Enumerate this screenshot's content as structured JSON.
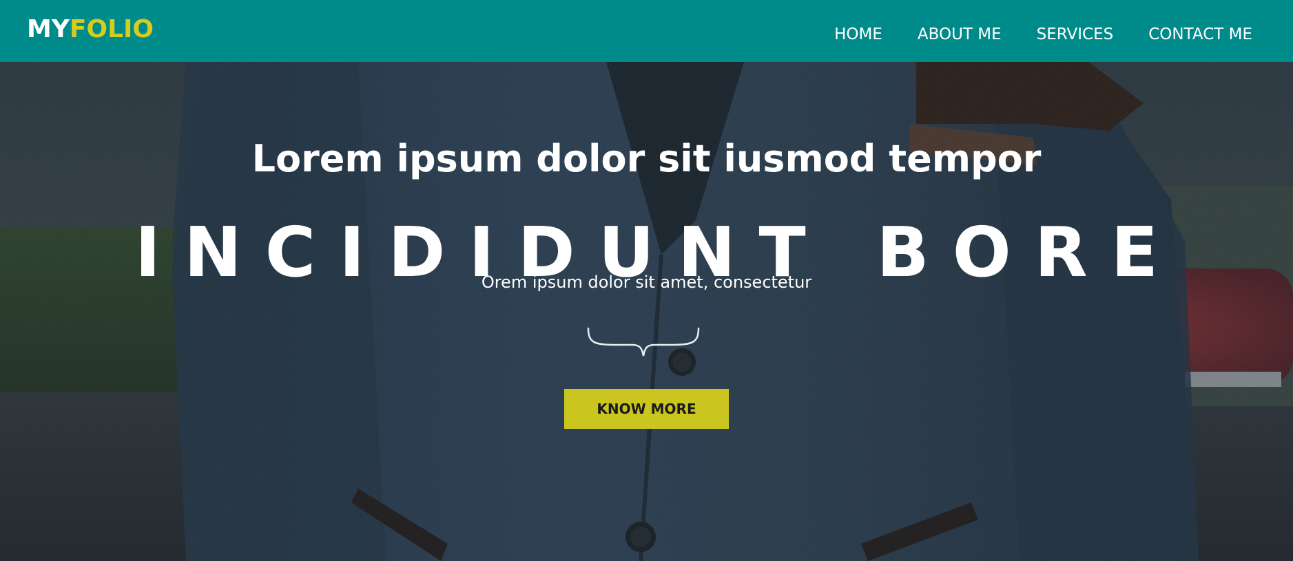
{
  "header": {
    "logo": {
      "part_a": "MY",
      "part_b": "FOLIO"
    },
    "nav": [
      {
        "label": "HOME"
      },
      {
        "label": "ABOUT ME"
      },
      {
        "label": "SERVICES"
      },
      {
        "label": "CONTACT ME"
      }
    ]
  },
  "hero": {
    "headline": "Lorem ipsum dolor sit iusmod tempor",
    "title": "INCIDIDUNT BORE",
    "subtitle": "Orem ipsum dolor sit amet, consectetur",
    "cta_label": "KNOW MORE",
    "divider_icon": "curly-brace-icon"
  },
  "colors": {
    "header_bg": "#008b8b",
    "accent": "#d4cc1f",
    "button_bg": "#cbc51f",
    "text": "#ffffff",
    "button_text": "#1a1a1a"
  }
}
